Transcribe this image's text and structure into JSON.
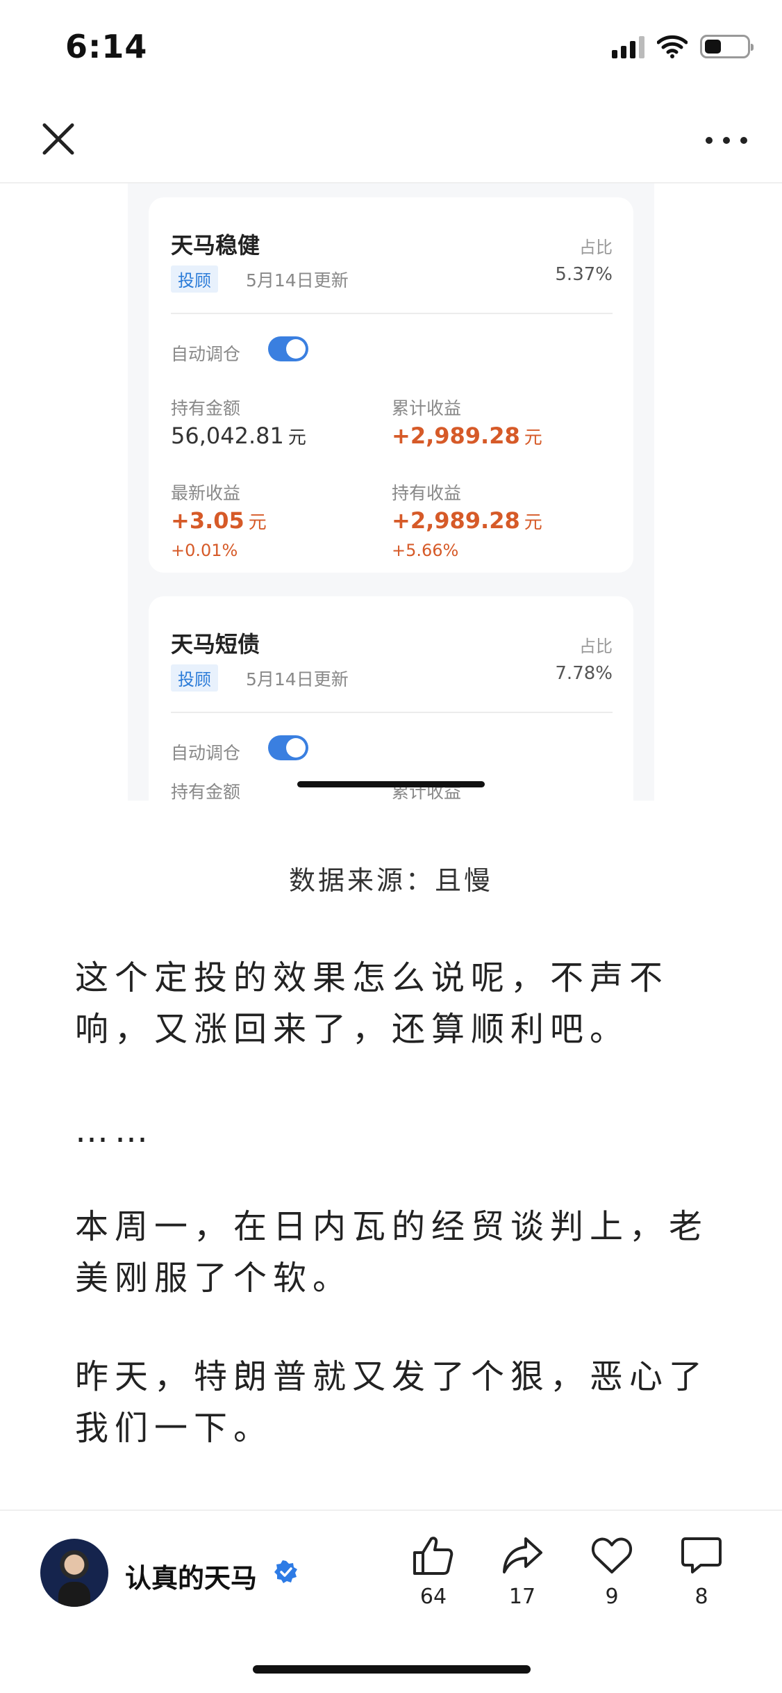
{
  "status_bar": {
    "time": "6:14",
    "battery_level": 0.4
  },
  "nav": {
    "close_icon": "close-icon",
    "more_icon": "more-icon"
  },
  "embed": {
    "cards": [
      {
        "title": "天马稳健",
        "tag": "投顾",
        "updated": "5月14日更新",
        "ratio_label": "占比",
        "ratio_value": "5.37%",
        "auto_label": "自动调仓",
        "holding_label": "持有金额",
        "holding_value": "56,042.81",
        "holding_unit": "元",
        "cum_label": "累计收益",
        "cum_value": "+2,989.28",
        "cum_unit": "元",
        "latest_label": "最新收益",
        "latest_value": "+3.05",
        "latest_unit": "元",
        "latest_pct": "+0.01%",
        "hold_profit_label": "持有收益",
        "hold_profit_value": "+2,989.28",
        "hold_profit_unit": "元",
        "hold_profit_pct": "+5.66%"
      },
      {
        "title": "天马短债",
        "tag": "投顾",
        "updated": "5月14日更新",
        "ratio_label": "占比",
        "ratio_value": "7.78%",
        "auto_label": "自动调仓",
        "holding_label": "持有金额",
        "cum_label": "累计收益"
      }
    ]
  },
  "article": {
    "source": "数据来源：且慢",
    "paragraphs": [
      "这个定投的效果怎么说呢，不声不响，又涨回来了，还算顺利吧。",
      "……",
      "本周一，在日内瓦的经贸谈判上，老美刚服了个软。",
      "昨天，特朗普就又发了个狠，恶心了我们一下。"
    ]
  },
  "bottom_bar": {
    "author": "认真的天马",
    "actions": [
      {
        "icon": "like-icon",
        "count": "64"
      },
      {
        "icon": "share-icon",
        "count": "17"
      },
      {
        "icon": "heart-icon",
        "count": "9"
      },
      {
        "icon": "comment-icon",
        "count": "8"
      }
    ]
  }
}
